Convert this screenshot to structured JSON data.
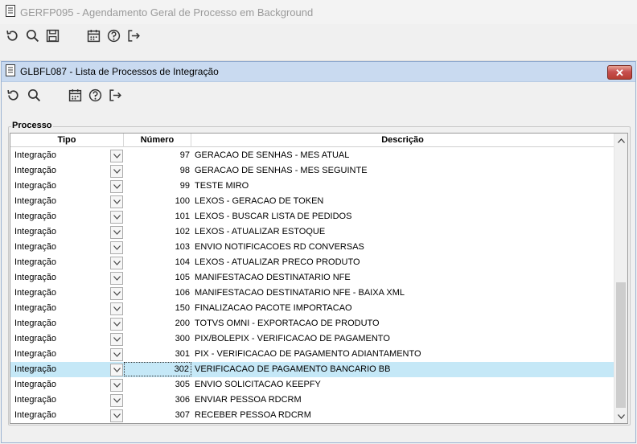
{
  "main_window": {
    "title": "GERFP095 - Agendamento Geral de Processo em Background",
    "toolbar": [
      {
        "icon": "refresh-icon"
      },
      {
        "icon": "search-icon"
      },
      {
        "icon": "save-icon"
      },
      {
        "icon": "calendar-icon"
      },
      {
        "icon": "help-icon"
      },
      {
        "icon": "exit-icon"
      }
    ]
  },
  "dialog": {
    "title": "GLBFL087 - Lista de Processos de Integração",
    "close_label": "✕",
    "toolbar": [
      {
        "icon": "refresh-icon"
      },
      {
        "icon": "search-icon"
      },
      {
        "icon": "calendar-icon"
      },
      {
        "icon": "help-icon"
      },
      {
        "icon": "exit-icon"
      }
    ],
    "group_label": "Processo",
    "columns": {
      "tipo": "Tipo",
      "numero": "Número",
      "descricao": "Descrição"
    },
    "rows": [
      {
        "tipo": "Integração",
        "numero": "97",
        "descricao": "GERACAO DE SENHAS - MES ATUAL"
      },
      {
        "tipo": "Integração",
        "numero": "98",
        "descricao": "GERACAO DE SENHAS - MES SEGUINTE"
      },
      {
        "tipo": "Integração",
        "numero": "99",
        "descricao": "TESTE MIRO"
      },
      {
        "tipo": "Integração",
        "numero": "100",
        "descricao": "LEXOS - GERACAO DE TOKEN"
      },
      {
        "tipo": "Integração",
        "numero": "101",
        "descricao": "LEXOS - BUSCAR LISTA DE PEDIDOS"
      },
      {
        "tipo": "Integração",
        "numero": "102",
        "descricao": "LEXOS - ATUALIZAR ESTOQUE"
      },
      {
        "tipo": "Integração",
        "numero": "103",
        "descricao": "ENVIO NOTIFICACOES RD CONVERSAS"
      },
      {
        "tipo": "Integração",
        "numero": "104",
        "descricao": "LEXOS - ATUALIZAR PRECO PRODUTO"
      },
      {
        "tipo": "Integração",
        "numero": "105",
        "descricao": "MANIFESTACAO DESTINATARIO NFE"
      },
      {
        "tipo": "Integração",
        "numero": "106",
        "descricao": "MANIFESTACAO DESTINATARIO NFE - BAIXA XML"
      },
      {
        "tipo": "Integração",
        "numero": "150",
        "descricao": "FINALIZACAO PACOTE IMPORTACAO"
      },
      {
        "tipo": "Integração",
        "numero": "200",
        "descricao": "TOTVS OMNI - EXPORTACAO DE PRODUTO"
      },
      {
        "tipo": "Integração",
        "numero": "300",
        "descricao": "PIX/BOLEPIX - VERIFICACAO DE PAGAMENTO"
      },
      {
        "tipo": "Integração",
        "numero": "301",
        "descricao": "PIX - VERIFICACAO DE PAGAMENTO ADIANTAMENTO"
      },
      {
        "tipo": "Integração",
        "numero": "302",
        "descricao": "VERIFICACAO DE PAGAMENTO BANCARIO BB",
        "selected": true
      },
      {
        "tipo": "Integração",
        "numero": "305",
        "descricao": "ENVIO SOLICITACAO KEEPFY"
      },
      {
        "tipo": "Integração",
        "numero": "306",
        "descricao": "ENVIAR PESSOA RDCRM"
      },
      {
        "tipo": "Integração",
        "numero": "307",
        "descricao": "RECEBER PESSOA RDCRM"
      }
    ]
  },
  "colors": {
    "selected_row": "#c5e8f7",
    "dialog_titlebar": "#c9daf0",
    "close_button": "#c75050"
  }
}
